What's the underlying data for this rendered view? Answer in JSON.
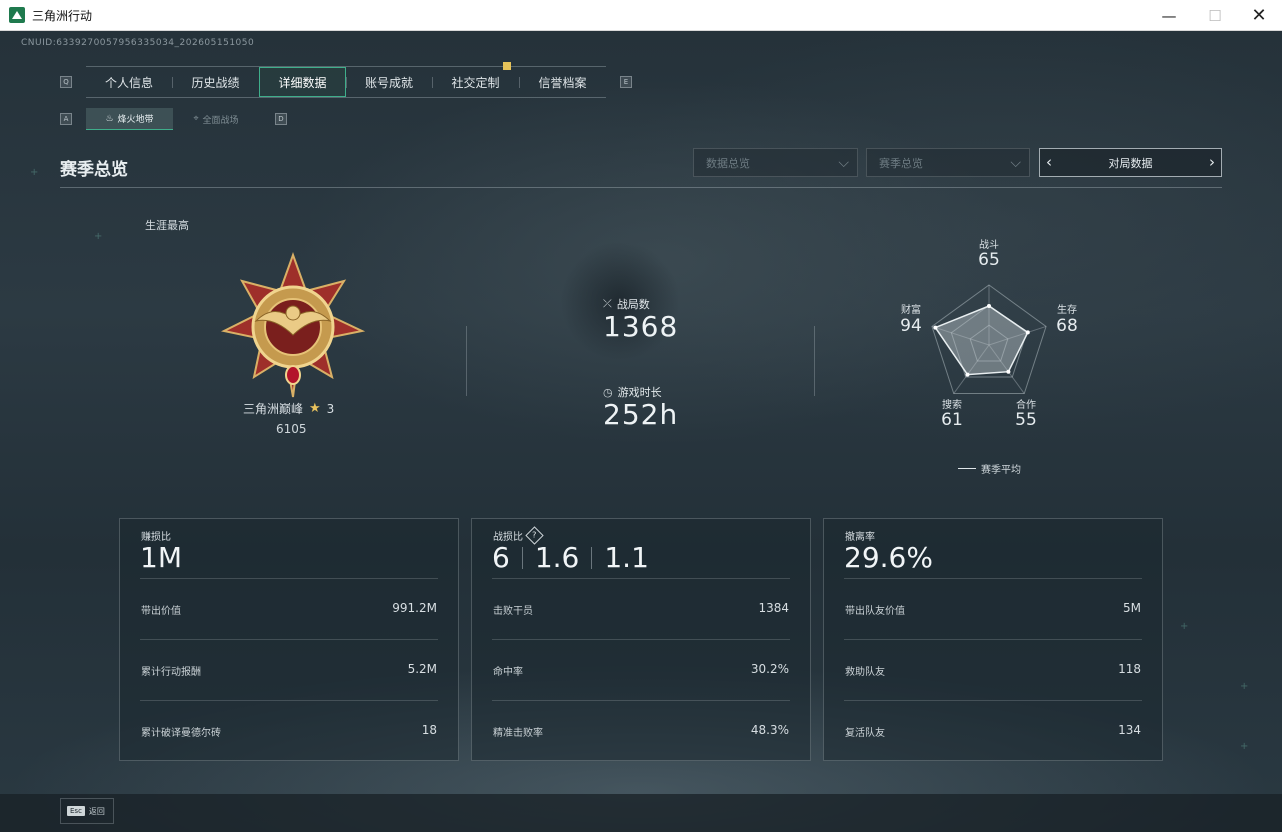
{
  "window": {
    "title": "三角洲行动",
    "minimize": "—",
    "maximize": "☐",
    "close": "✕"
  },
  "uid": "CNUID:6339270057956335034_202605151050",
  "tabs": {
    "left_key": "Q",
    "right_key": "E",
    "items": [
      {
        "label": "个人信息"
      },
      {
        "label": "历史战绩"
      },
      {
        "label": "详细数据",
        "active": true
      },
      {
        "label": "账号成就"
      },
      {
        "label": "社交定制",
        "badge": true
      },
      {
        "label": "信誉档案"
      }
    ]
  },
  "subtabs": {
    "left_key": "A",
    "right_key": "D",
    "items": [
      {
        "label": "烽火地带",
        "active": true,
        "icon": "flame-icon"
      },
      {
        "label": "全面战场",
        "icon": "crosshair-icon"
      }
    ]
  },
  "section": {
    "title": "赛季总览",
    "dropdown1": "数据总览",
    "dropdown2": "赛季总览",
    "match_nav": "对局数据"
  },
  "career": {
    "label": "生涯最高",
    "rank_name": "三角洲巅峰",
    "stars": "3",
    "score": "6105"
  },
  "stats": {
    "matches_label": "战局数",
    "matches_value": "1368",
    "playtime_label": "游戏时长",
    "playtime_value": "252h"
  },
  "radar": {
    "axes": [
      {
        "label": "战斗",
        "value": "65"
      },
      {
        "label": "生存",
        "value": "68"
      },
      {
        "label": "合作",
        "value": "55"
      },
      {
        "label": "搜索",
        "value": "61"
      },
      {
        "label": "财富",
        "value": "94"
      }
    ],
    "scores": [
      65,
      68,
      55,
      61,
      94
    ],
    "legend": "赛季平均"
  },
  "cards": [
    {
      "label": "赚损比",
      "big": [
        "1M"
      ],
      "rows": [
        {
          "label": "带出价值",
          "value": "991.2M"
        },
        {
          "label": "累计行动报酬",
          "value": "5.2M"
        },
        {
          "label": "累计破译曼德尔砖",
          "value": "18"
        }
      ]
    },
    {
      "label": "战损比",
      "help": "?",
      "big": [
        "6",
        "1.6",
        "1.1"
      ],
      "rows": [
        {
          "label": "击败干员",
          "value": "1384"
        },
        {
          "label": "命中率",
          "value": "30.2%"
        },
        {
          "label": "精准击败率",
          "value": "48.3%"
        }
      ]
    },
    {
      "label": "撤离率",
      "big": [
        "29.6%"
      ],
      "rows": [
        {
          "label": "带出队友价值",
          "value": "5M"
        },
        {
          "label": "救助队友",
          "value": "118"
        },
        {
          "label": "复活队友",
          "value": "134"
        }
      ]
    }
  ],
  "footer": {
    "key": "Esc",
    "label": "返回"
  },
  "colors": {
    "accent": "#3fae8b",
    "badge": "#e6c35a",
    "star": "#e8c25d"
  }
}
